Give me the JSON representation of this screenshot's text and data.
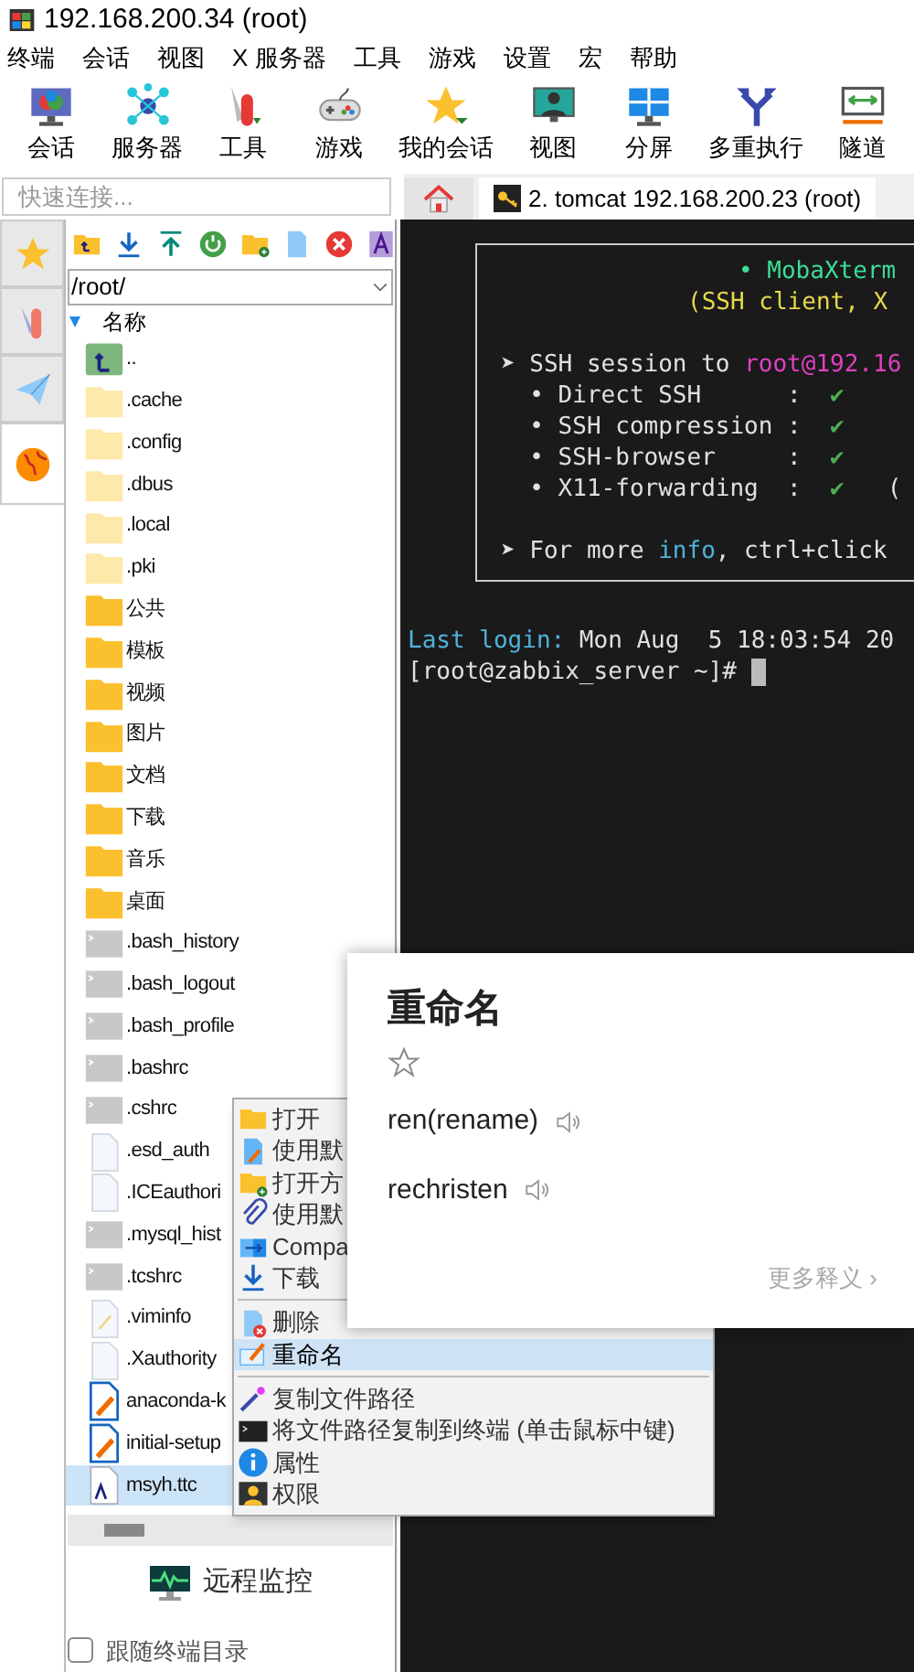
{
  "window": {
    "title": "192.168.200.34 (root)"
  },
  "menu_bar": [
    "终端",
    "会话",
    "视图",
    "X 服务器",
    "工具",
    "游戏",
    "设置",
    "宏",
    "帮助"
  ],
  "toolbar": [
    "会话",
    "服务器",
    "工具",
    "游戏",
    "我的会话",
    "视图",
    "分屏",
    "多重执行",
    "隧道"
  ],
  "quick_connect": {
    "placeholder": "快速连接..."
  },
  "tabs": [
    {
      "kind": "home",
      "selected": false
    },
    {
      "kind": "session",
      "label": "2. tomcat 192.168.200.23 (root)",
      "selected": true
    }
  ],
  "side_tabs": [
    {
      "selected": false
    },
    {
      "selected": false
    },
    {
      "selected": false
    },
    {
      "selected": true
    }
  ],
  "file_browser": {
    "path": "/root/",
    "column": "名称",
    "files": [
      {
        "name": "..",
        "kind": "parent",
        "selected": false
      },
      {
        "name": ".cache",
        "kind": "hidden-folder",
        "selected": false
      },
      {
        "name": ".config",
        "kind": "hidden-folder",
        "selected": false
      },
      {
        "name": ".dbus",
        "kind": "hidden-folder",
        "selected": false
      },
      {
        "name": ".local",
        "kind": "hidden-folder",
        "selected": false
      },
      {
        "name": ".pki",
        "kind": "hidden-folder",
        "selected": false
      },
      {
        "name": "公共",
        "kind": "folder",
        "selected": false
      },
      {
        "name": "模板",
        "kind": "folder",
        "selected": false
      },
      {
        "name": "视频",
        "kind": "folder",
        "selected": false
      },
      {
        "name": "图片",
        "kind": "folder",
        "selected": false
      },
      {
        "name": "文档",
        "kind": "folder",
        "selected": false
      },
      {
        "name": "下载",
        "kind": "folder",
        "selected": false
      },
      {
        "name": "音乐",
        "kind": "folder",
        "selected": false
      },
      {
        "name": "桌面",
        "kind": "folder",
        "selected": false
      },
      {
        "name": ".bash_history",
        "kind": "shell",
        "selected": false
      },
      {
        "name": ".bash_logout",
        "kind": "shell",
        "selected": false
      },
      {
        "name": ".bash_profile",
        "kind": "shell",
        "selected": false
      },
      {
        "name": ".bashrc",
        "kind": "shell",
        "selected": false
      },
      {
        "name": ".cshrc",
        "kind": "shell",
        "selected": false
      },
      {
        "name": ".esd_auth",
        "kind": "file",
        "selected": false
      },
      {
        "name": ".ICEauthori",
        "kind": "file",
        "selected": false
      },
      {
        "name": ".mysql_hist",
        "kind": "shell",
        "selected": false
      },
      {
        "name": ".tcshrc",
        "kind": "shell",
        "selected": false
      },
      {
        "name": ".viminfo",
        "kind": "text",
        "selected": false
      },
      {
        "name": ".Xauthority",
        "kind": "file",
        "selected": false
      },
      {
        "name": "anaconda-k",
        "kind": "script",
        "selected": false
      },
      {
        "name": "initial-setup",
        "kind": "script",
        "selected": false
      },
      {
        "name": "msyh.ttc",
        "kind": "font",
        "selected": true
      }
    ],
    "monitor_button": "远程监控",
    "follow_terminal": {
      "label": "跟随终端目录",
      "checked": false
    }
  },
  "terminal": {
    "banner_title": "• MobaXterm",
    "banner_subtitle": "(SSH client, X",
    "session_prefix": "➤ SSH session to ",
    "session_host": "root@192.16",
    "features": [
      {
        "text": "  • Direct SSH      :",
        "mark": "✔"
      },
      {
        "text": "  • SSH compression :",
        "mark": "✔"
      },
      {
        "text": "  • SSH-browser     :",
        "mark": "✔"
      },
      {
        "text": "  • X11-forwarding  :",
        "mark": "✔",
        "note": "("
      }
    ],
    "info_prefix": "➤ For more ",
    "info_link": "info",
    "info_suffix": ", ctrl+click",
    "last_login_label": "Last login:",
    "last_login_value": " Mon Aug  5 18:03:54 20",
    "prompt": "[root@zabbix_server ~]# "
  },
  "context_menu": [
    [
      {
        "label": "打开",
        "selected": false
      },
      {
        "label": "使用默",
        "selected": false
      },
      {
        "label": "打开方",
        "selected": false
      },
      {
        "label": "使用默",
        "selected": false
      },
      {
        "label": "Compa",
        "selected": false
      },
      {
        "label": "下载",
        "selected": false
      }
    ],
    [
      {
        "label": "删除",
        "selected": false
      },
      {
        "label": "重命名",
        "selected": true
      }
    ],
    [
      {
        "label": "复制文件路径",
        "selected": false
      },
      {
        "label": "将文件路径复制到终端 (单击鼠标中键)",
        "selected": false
      },
      {
        "label": "属性",
        "selected": false
      },
      {
        "label": "权限",
        "selected": false
      }
    ]
  ],
  "translation_popup": {
    "word": "重命名",
    "translations": [
      "ren(rename)",
      "rechristen"
    ],
    "more_link": "更多释义 ›"
  }
}
